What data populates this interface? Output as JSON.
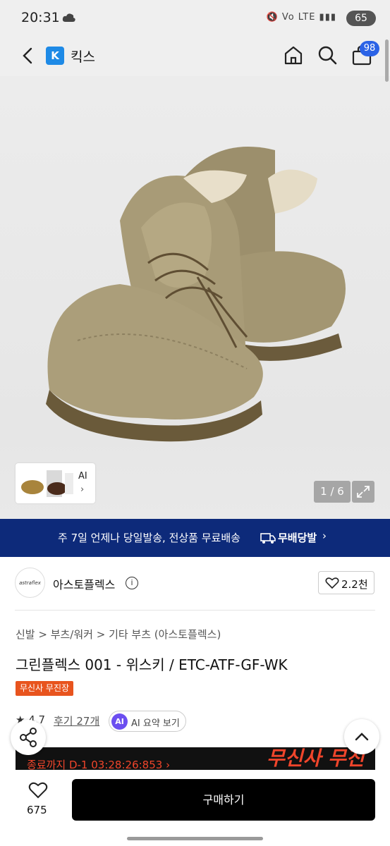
{
  "status_bar": {
    "time": "20:31",
    "network": "Vo LTE",
    "battery": "65"
  },
  "header": {
    "app_name": "킥스",
    "logo_letter": "K",
    "cart_badge": "98"
  },
  "gallery": {
    "ai_label": "AI",
    "ai_chevron": "›",
    "pager": "1 / 6"
  },
  "promo": {
    "text": "주 7일 언제나 당일발송, 전상품 무료배송",
    "brand": "무배당발",
    "chevron": "›"
  },
  "brand": {
    "logo_text": "astraflex",
    "name": "아스토플렉스",
    "info": "i",
    "likes": "2.2천"
  },
  "product": {
    "breadcrumb": "신발 > 부츠/워커 > 기타 부츠 (아스토플렉스)",
    "title": "그린플렉스 001 - 위스키 / ETC-ATF-GF-WK",
    "tag": "무신사 무진장",
    "rating": "4.7",
    "reviews": "후기 27개",
    "ai_badge": "AI",
    "ai_summary": "AI 요약 보기"
  },
  "countdown": {
    "text": "종료까지 D-1 03:28:26:853 ›",
    "deco": "무신사 무진장"
  },
  "bottom_bar": {
    "like_count": "675",
    "buy_label": "구매하기"
  }
}
